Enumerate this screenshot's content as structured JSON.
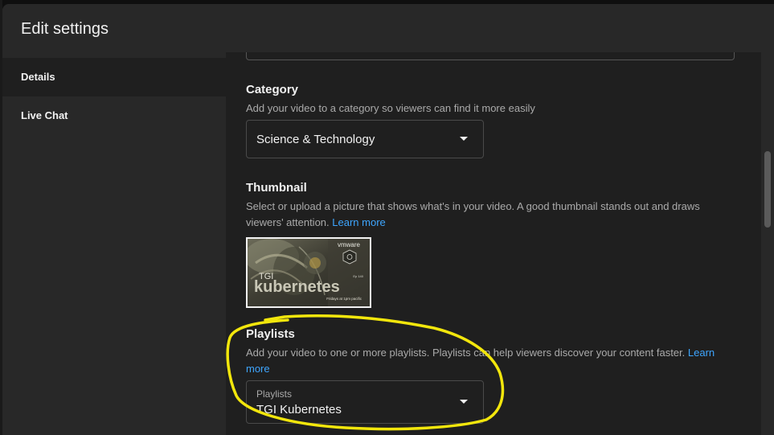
{
  "dialog": {
    "title": "Edit settings"
  },
  "sidebar": {
    "items": [
      {
        "label": "Details",
        "active": true
      },
      {
        "label": "Live Chat",
        "active": false
      }
    ]
  },
  "category": {
    "title": "Category",
    "description": "Add your video to a category so viewers can find it more easily",
    "selected": "Science & Technology"
  },
  "thumbnail": {
    "title": "Thumbnail",
    "description": "Select or upload a picture that shows what's in your video. A good thumbnail stands out and draws viewers' attention.",
    "learn_more": "Learn more",
    "image": {
      "brand": "vmware",
      "badge": "Ep 140",
      "line1": "TGI",
      "line2": "kubernetes",
      "footer": "Fridays at 1pm pacific"
    }
  },
  "playlists": {
    "title": "Playlists",
    "description": "Add your video to one or more playlists. Playlists can help viewers discover your content faster.",
    "learn_more": "Learn more",
    "field_label": "Playlists",
    "selected": "TGI Kubernetes"
  },
  "colors": {
    "background": "#1f1f1f",
    "panel": "#282828",
    "text": "#f1f1f1",
    "muted": "#aaaaaa",
    "link": "#3ea6ff",
    "annotation": "#f2e60c"
  },
  "icons": {
    "dropdown": "caret-down-icon"
  }
}
